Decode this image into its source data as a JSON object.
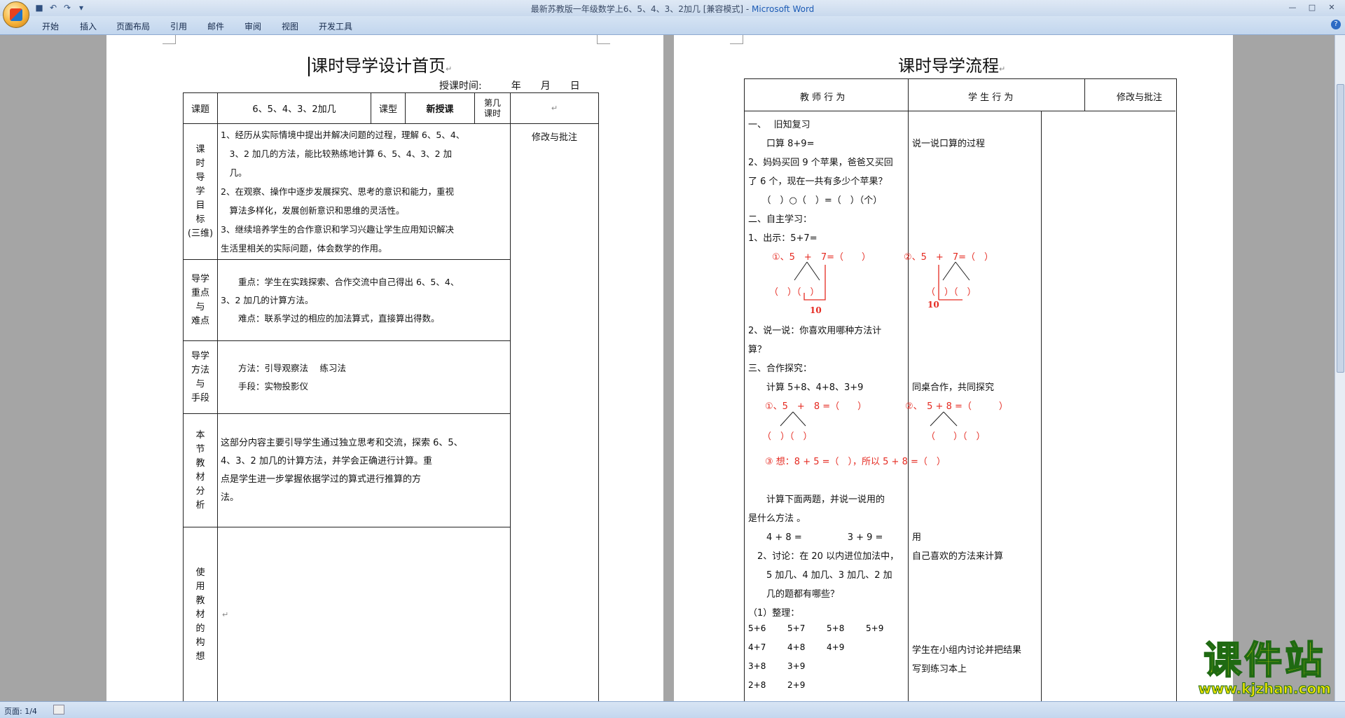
{
  "window": {
    "title": "最新苏教版一年级数学上6、5、4、3、2加几 [兼容模式] - ",
    "app_name": "Microsoft Word"
  },
  "ribbon": {
    "tabs": [
      "开始",
      "插入",
      "页面布局",
      "引用",
      "邮件",
      "审阅",
      "视图",
      "开发工具"
    ]
  },
  "status": {
    "page_indicator": "页面: 1/4"
  },
  "page1": {
    "title": "课时导学设计首页",
    "date_line": "授课时间:　　　年　　月　　日",
    "header_row": {
      "topic_label": "课题",
      "topic_value": "6、5、4、3、2加几",
      "type_label": "课型",
      "type_value": "新授课",
      "period_label_line1": "第几",
      "period_label_line2": "课时"
    },
    "goals_label": [
      "课",
      "时",
      "导",
      "学",
      "目",
      "标",
      "(三维)"
    ],
    "goals_text": [
      "1、经历从实际情境中提出并解决问题的过程，理解 6、5、4、",
      "　3、2 加几的方法，能比较熟练地计算 6、5、4、3、2 加",
      "　几。",
      "2、在观察、操作中逐步发展探究、思考的意识和能力，重视",
      "　算法多样化，发展创新意识和思维的灵活性。",
      "3、继续培养学生的合作意识和学习兴趣让学生应用知识解决",
      "生活里相关的实际问题，体会数学的作用。"
    ],
    "review_label": "修改与批注",
    "focus_label": [
      "导学",
      "重点",
      "与",
      "难点"
    ],
    "focus_text": [
      "　　重点：学生在实践探索、合作交流中自己得出 6、5、4、",
      "3、2 加几的计算方法。",
      "　　难点：联系学过的相应的加法算式，直接算出得数。"
    ],
    "method_label": [
      "导学",
      "方法",
      "与",
      "手段"
    ],
    "method_text": [
      "　　方法：引导观察法　 练习法",
      "　　手段：实物投影仪"
    ],
    "analysis_label": [
      "本",
      "节",
      "教",
      "材",
      "分",
      "析"
    ],
    "analysis_text": [
      "这部分内容主要引导学生通过独立思考和交流，探索 6、5、",
      "4、3、2 加几的计算方法，并学会正确进行计算。重",
      "点是学生进一步掌握依据学过的算式进行推算的方",
      "法。"
    ],
    "usage_label": [
      "使",
      "用",
      "教",
      "材",
      "的",
      "构",
      "想"
    ]
  },
  "page2": {
    "title": "课时导学流程",
    "col_teacher": "教 师 行 为",
    "col_student": "学 生 行 为",
    "col_review": "修改与批注",
    "teacher_lines": [
      "一、　 旧知复习",
      "　　口算 8+9=",
      " 2、妈妈买回 9 个苹果，爸爸又买回",
      "了 6 个，现在一共有多少个苹果？",
      "　　（　）○（　）=（　）（个）",
      "二、自主学习：",
      " 1、出示：5+7=",
      " 2、说一说：你喜欢用哪种方法计",
      "算？",
      "三、合作探究：",
      "　　计算 5+8、4+8、3+9",
      "　　计算下面两题，并说一说用的",
      "是什么方法 。",
      "　　4 + 8 =　　　　　3 + 9 =",
      "　2、讨论：在 20 以内进位加法中，",
      "　　5 加几、4 加几、3 加几、2 加",
      "　　几的题都有哪些？",
      " （1）整理："
    ],
    "student_lines": {
      "oral": "说一说口算的过程",
      "coop": "同桌合作，共同探究",
      "use1": "用",
      "use2": "自己喜欢的方法来计算",
      "group1": "学生在小组内讨论并把结果",
      "group2": "写到练习本上"
    },
    "red_expressions": {
      "ex1": "①、5　+　7=（　　）",
      "ex2": "②、5　+　7=（　）",
      "ex1_split": "（　）（　）",
      "ex2_split": "（　）（　）",
      "ten": "10",
      "ex3": "①、5　+　8 =（　　）",
      "ex4": "②、　5 + 8 =（　　　）",
      "ex3_split": "（　）（　）",
      "ex4_split": "（　　）（　）",
      "think": "③ 想：8 + 5 =（　），所以 5 + 8 =（　）"
    },
    "arrangement": [
      [
        "5+6",
        "5+7",
        "5+8",
        "5+9"
      ],
      [
        "4+7",
        "4+8",
        "4+9"
      ],
      [
        "3+8",
        "3+9"
      ],
      [
        "2+8",
        "2+9"
      ]
    ]
  },
  "watermark": {
    "brand": "课件站",
    "url": "www.kjzhan.com"
  }
}
